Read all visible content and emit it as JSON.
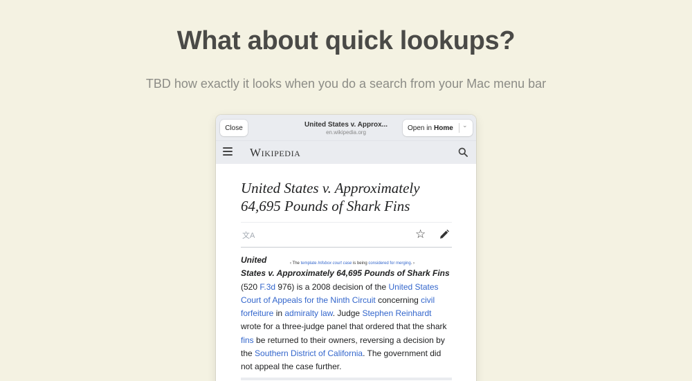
{
  "page": {
    "headline": "What about quick lookups?",
    "subline": "TBD how exactly it looks when you do a search from your Mac menu bar"
  },
  "browser": {
    "close_label": "Close",
    "title": "United States v. Approx...",
    "domain": "en.wikipedia.org",
    "open_in_prefix": "Open in",
    "open_in_target": "Home",
    "chevron_icon": "chevron-down-icon"
  },
  "wiki": {
    "wordmark": "Wikipedia",
    "menu_icon": "hamburger-icon",
    "search_icon": "search-icon",
    "article_title": "United States v. Approximately 64,695 Pounds of Shark Fins",
    "tools": {
      "language_icon": "translate-icon",
      "watch_icon": "star-icon",
      "edit_icon": "pencil-icon"
    },
    "merge_notice": {
      "prefix": "‹ The",
      "link1": "template",
      "link2": "Infobox court case",
      "middle": "is being",
      "link3": "considered for merging",
      "suffix": ". ›"
    },
    "lead": {
      "b1": "United",
      "b2": "States v. Approximately 64,695 Pounds of Shark",
      "b3": "Fins",
      "t1": " (520 ",
      "l1": "F.3d",
      "t2": " 976) is a 2008 decision of the ",
      "l2": "United States Court of Appeals for the Ninth Circuit",
      "t3": " concerning ",
      "l3": "civil forfeiture",
      "t4": " in ",
      "l4": "admiralty law",
      "t5": ". Judge ",
      "l5": "Stephen Reinhardt",
      "t6": " wrote for a three-judge panel that ordered that the shark ",
      "l6": "fins",
      "t7": " be returned to their owners, reversing a decision by the ",
      "l7": "Southern District of California",
      "t8": ". The government did not appeal the case further."
    }
  },
  "colors": {
    "background": "#f4f2e2",
    "headline": "#4a4a47",
    "link": "#3366cc",
    "chrome": "#eaecf0"
  }
}
